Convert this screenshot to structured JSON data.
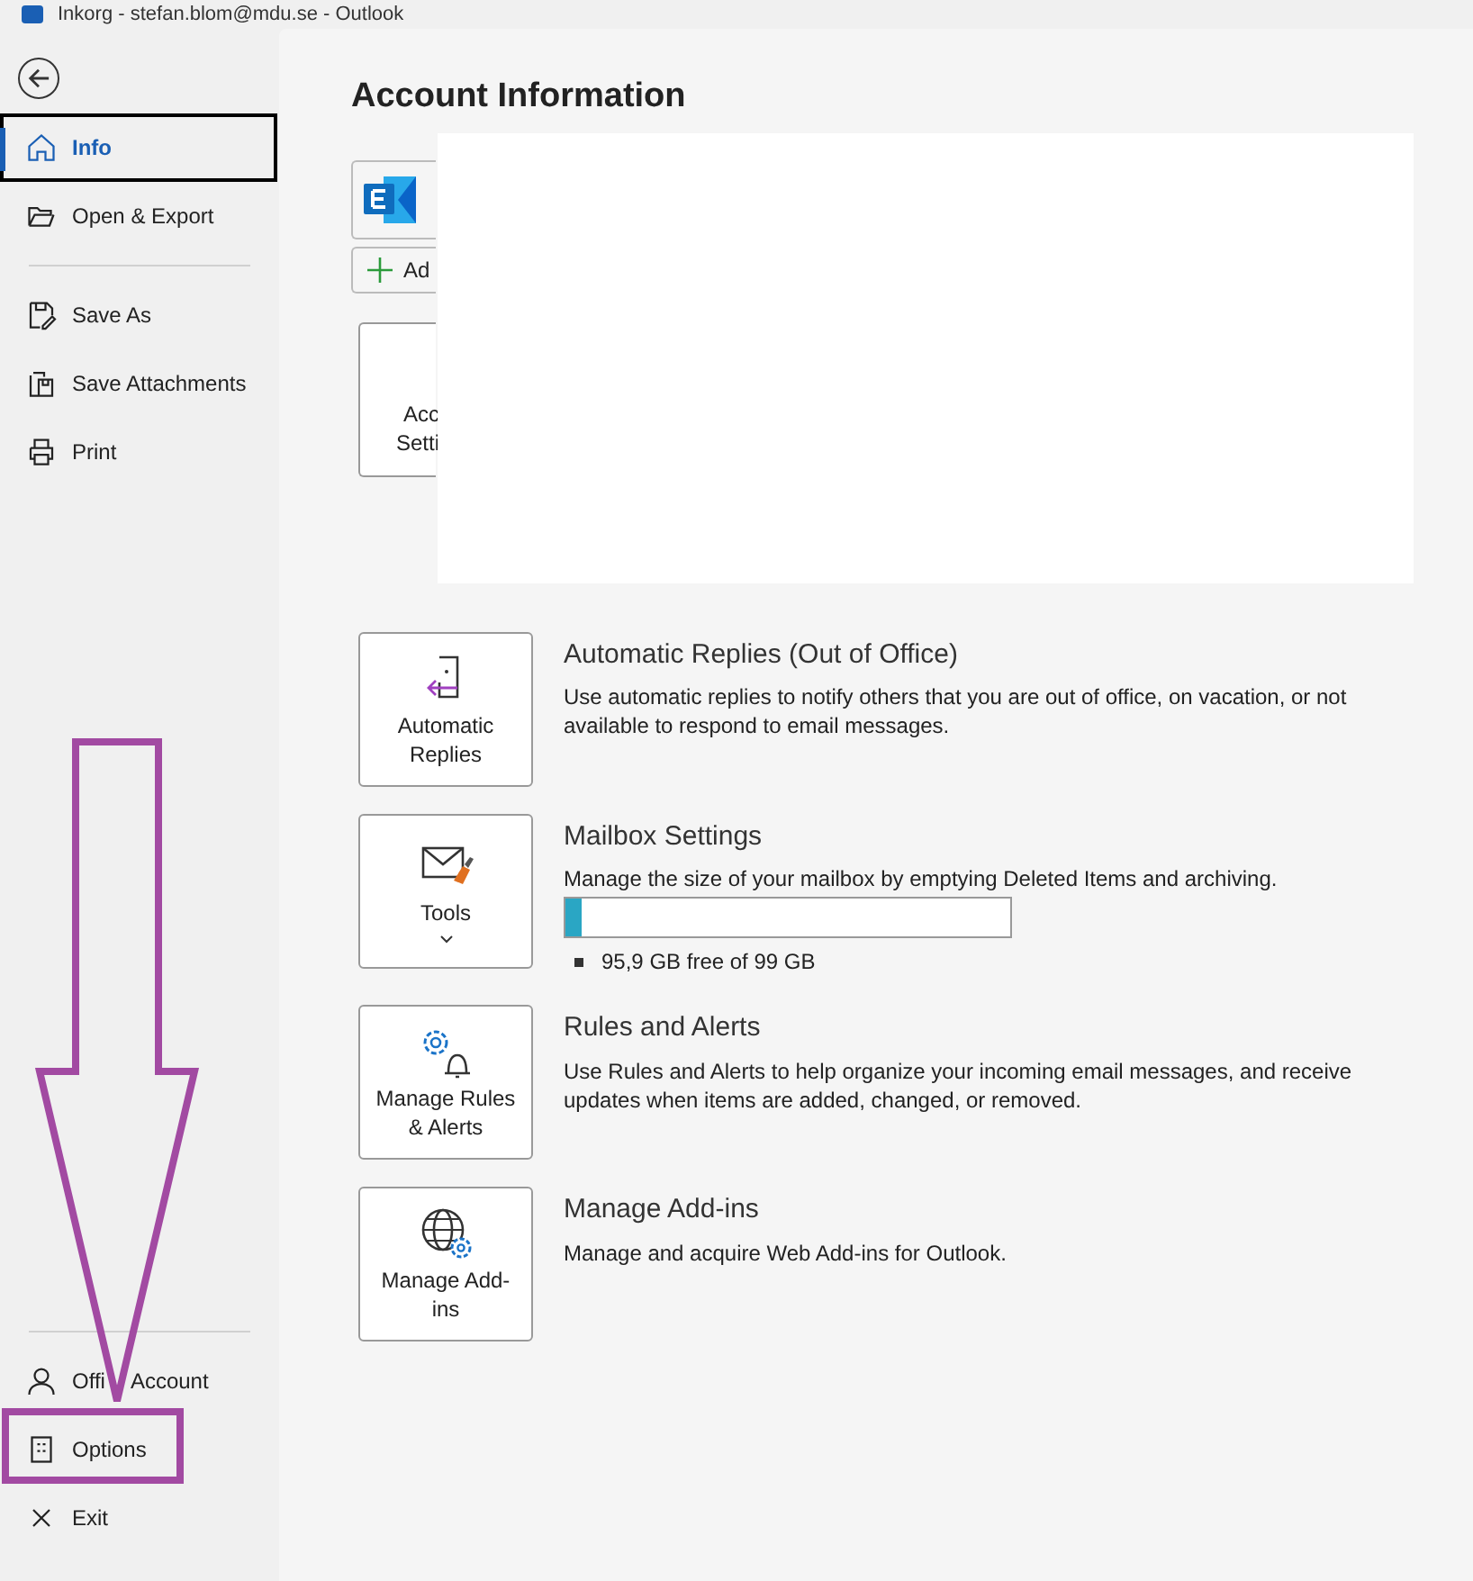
{
  "window": {
    "title": "Inkorg - stefan.blom@mdu.se - Outlook"
  },
  "sidebar": {
    "items": [
      {
        "kind": "item",
        "label": "Info",
        "selected": true
      },
      {
        "kind": "item",
        "label": "Open & Export",
        "selected": false
      },
      {
        "kind": "divider"
      },
      {
        "kind": "item",
        "label": "Save As",
        "selected": false
      },
      {
        "kind": "item",
        "label": "Save Attachments",
        "selected": false
      },
      {
        "kind": "item",
        "label": "Print",
        "selected": false
      }
    ],
    "bottom_items": [
      {
        "kind": "divider"
      },
      {
        "kind": "item",
        "label": [
          "Offi",
          "Account"
        ],
        "selected": false
      },
      {
        "kind": "item",
        "label": "Options",
        "selected": false
      },
      {
        "kind": "item",
        "label": "Exit",
        "selected": false
      }
    ]
  },
  "main": {
    "title": "Account Information",
    "account": {
      "add_button": "Ad",
      "settings_button": [
        "Acc",
        "Setti"
      ]
    },
    "sections": [
      {
        "button": [
          "Automatic",
          "Replies"
        ],
        "title": "Automatic Replies (Out of Office)",
        "description": "Use automatic replies to notify others that you are out of office, on vacation, or not available to respond to email messages."
      },
      {
        "button": [
          "Tools"
        ],
        "dropdown": true,
        "title": "Mailbox Settings",
        "description": "Manage the size of your mailbox by emptying Deleted Items and archiving.",
        "level": 0.035,
        "reading": "95,9 GB free of 99 GB"
      },
      {
        "button": [
          "Manage Rules",
          "& Alerts"
        ],
        "title": "Rules and Alerts",
        "description": "Use Rules and Alerts to help organize your incoming email messages, and receive updates when items are added, changed, or removed."
      },
      {
        "button": [
          "Manage Add-",
          "ins"
        ],
        "title": "Manage Add-ins",
        "description": "Manage and acquire Web Add-ins for Outlook."
      }
    ]
  }
}
